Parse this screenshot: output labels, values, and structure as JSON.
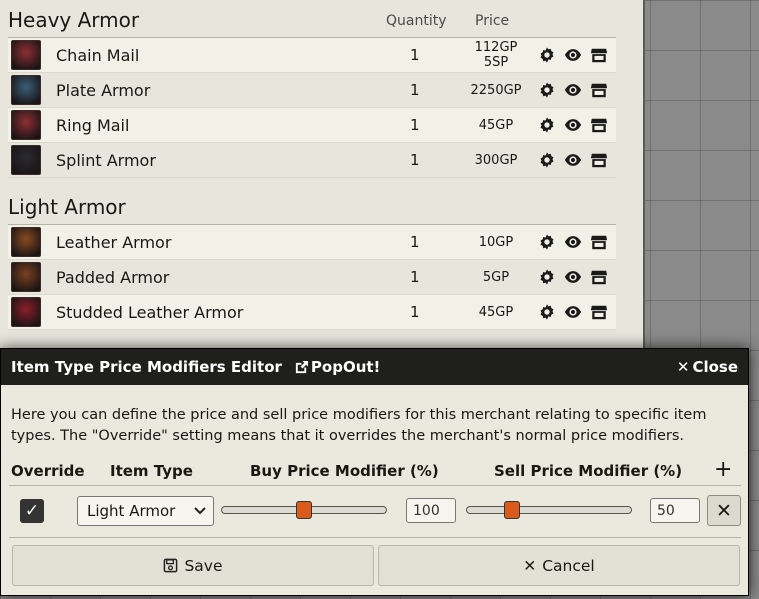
{
  "heavy": {
    "title": "Heavy Armor",
    "col_quantity": "Quantity",
    "col_price": "Price",
    "items": [
      {
        "name": "Chain Mail",
        "qty": "1",
        "price": "112GP 5SP",
        "icon_color": "#8c2f35"
      },
      {
        "name": "Plate Armor",
        "qty": "1",
        "price": "2250GP",
        "icon_color": "#3b5f7a"
      },
      {
        "name": "Ring Mail",
        "qty": "1",
        "price": "45GP",
        "icon_color": "#8c2f35"
      },
      {
        "name": "Splint Armor",
        "qty": "1",
        "price": "300GP",
        "icon_color": "#2a2a30"
      }
    ]
  },
  "light": {
    "title": "Light Armor",
    "items": [
      {
        "name": "Leather Armor",
        "qty": "1",
        "price": "10GP",
        "icon_color": "#8a4a20"
      },
      {
        "name": "Padded Armor",
        "qty": "1",
        "price": "5GP",
        "icon_color": "#7a4020"
      },
      {
        "name": "Studded Leather Armor",
        "qty": "1",
        "price": "45GP",
        "icon_color": "#8a1f2a"
      }
    ]
  },
  "action_icons": [
    "gear-icon",
    "eye-icon",
    "store-icon"
  ],
  "dialog": {
    "title": "Item Type Price Modifiers Editor",
    "popout": "PopOut!",
    "close": "Close",
    "description": "Here you can define the price and sell price modifiers for this merchant relating to specific item types. The \"Override\" setting means that it overrides the merchant's normal price modifiers.",
    "headers": {
      "override": "Override",
      "item_type": "Item Type",
      "buy": "Buy Price Modifier (%)",
      "sell": "Sell Price Modifier (%)",
      "add": "+"
    },
    "row": {
      "override_checked": true,
      "check": "✓",
      "item_type": "Light Armor",
      "buy_value": "100",
      "sell_value": "50",
      "buy_fraction": 0.5,
      "sell_fraction": 0.25,
      "remove": "✕"
    },
    "save": "Save",
    "cancel": "Cancel"
  },
  "colors": {
    "accent": "#d95a1a",
    "header_bg": "#1f1f1c"
  }
}
